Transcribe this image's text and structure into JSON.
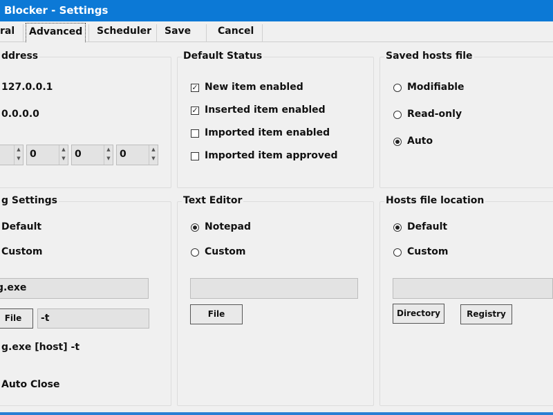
{
  "window": {
    "title": "Blocker - Settings"
  },
  "tabs": {
    "general": "ral",
    "advanced": "Advanced",
    "scheduler": "Scheduler",
    "save": "Save",
    "cancel": "Cancel"
  },
  "address_group": {
    "title": "ddress",
    "addr1": "127.0.0.1",
    "addr2": "0.0.0.0",
    "octets": [
      "",
      "0",
      "0",
      "0"
    ]
  },
  "default_status": {
    "title": "Default Status",
    "items": [
      {
        "label": "New item enabled",
        "checked": true
      },
      {
        "label": "Inserted item enabled",
        "checked": true
      },
      {
        "label": "Imported item enabled",
        "checked": false
      },
      {
        "label": "Imported item approved",
        "checked": false
      }
    ]
  },
  "saved_hosts": {
    "title": "Saved hosts file",
    "options": [
      "Modifiable",
      "Read-only",
      "Auto"
    ],
    "selected": "Auto"
  },
  "ping_settings": {
    "title": "g Settings",
    "opt_default": "Default",
    "opt_custom": "Custom",
    "exe_value": "g.exe",
    "file_button": "File",
    "args_value": "-t",
    "command_preview": "g.exe [host] -t",
    "auto_close": "Auto Close"
  },
  "text_editor": {
    "title": "Text Editor",
    "opt_notepad": "Notepad",
    "opt_custom": "Custom",
    "selected": "Notepad",
    "path_value": "",
    "file_button": "File"
  },
  "hosts_location": {
    "title": "Hosts file location",
    "opt_default": "Default",
    "opt_custom": "Custom",
    "selected": "Default",
    "path_value": "",
    "directory_button": "Directory",
    "registry_button": "Registry"
  },
  "colors": {
    "titlebar": "#0c79d6",
    "background": "#f0f0f0"
  },
  "icons": {
    "checkbox_mark": "✓"
  }
}
